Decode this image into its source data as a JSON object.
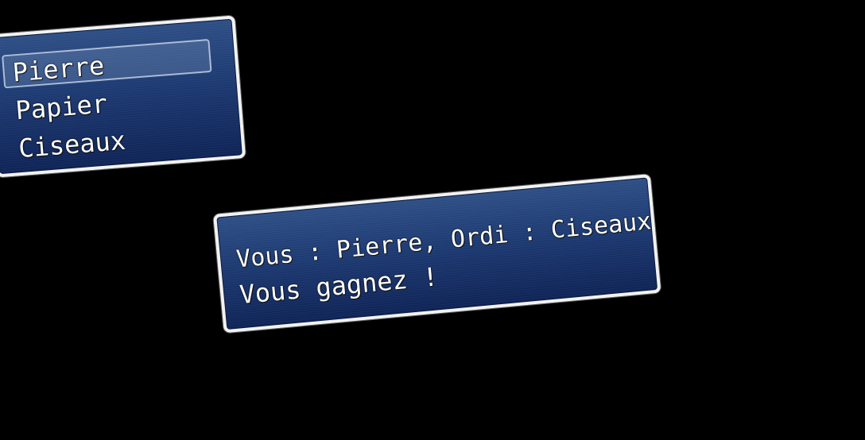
{
  "choices": {
    "items": [
      {
        "label": "Pierre",
        "selected": true
      },
      {
        "label": "Papier",
        "selected": false
      },
      {
        "label": "Ciseaux",
        "selected": false
      }
    ]
  },
  "message": {
    "line1": "Vous : Pierre, Ordi : Ciseaux",
    "line2": "Vous gagnez !"
  },
  "colors": {
    "background": "#000000",
    "window_top": "#2e4f86",
    "window_bottom": "#0f2457",
    "window_border": "#f2f2f2",
    "text": "#ffffff"
  }
}
